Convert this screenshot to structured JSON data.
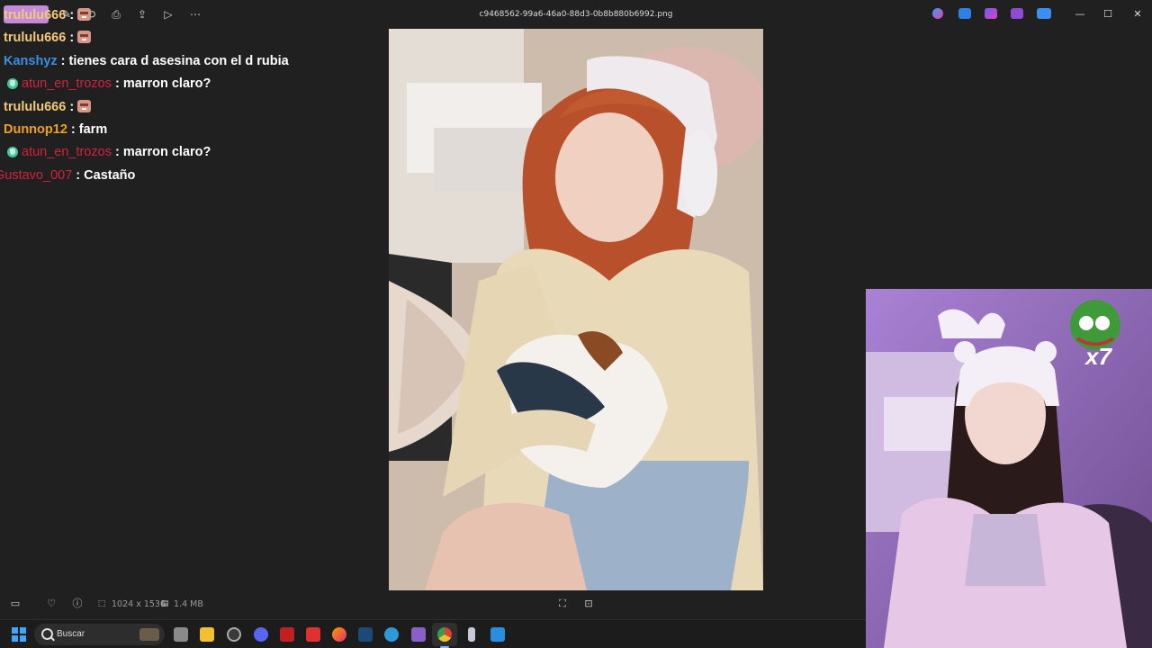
{
  "window": {
    "title": "c9468562-99a6-46a0-88d3-0b8b880b6992.png"
  },
  "toolbar_icons": [
    "image-edit-icon",
    "rotate-icon",
    "print-icon",
    "share-icon",
    "slideshow-icon",
    "more-icon"
  ],
  "chat": {
    "messages": [
      {
        "user": "trululu666",
        "color": "#f2c978",
        "badge": false,
        "text": "",
        "emote": true
      },
      {
        "user": "trululu666",
        "color": "#f2c978",
        "badge": false,
        "text": "",
        "emote": true
      },
      {
        "user": "Kanshyz",
        "color": "#3a8fe0",
        "badge": false,
        "text": "tienes cara d asesina con el d rubia",
        "emote": false
      },
      {
        "user": "atun_en_trozos",
        "color": "#d2223c",
        "badge": true,
        "text": "marron claro?",
        "emote": false
      },
      {
        "user": "trululu666",
        "color": "#f2c978",
        "badge": false,
        "text": "",
        "emote": true
      },
      {
        "user": "Dunnop12",
        "color": "#f0a020",
        "badge": false,
        "text": "farm",
        "emote": false
      },
      {
        "user": "atun_en_trozos",
        "color": "#d2223c",
        "badge": true,
        "text": "marron claro?",
        "emote": false
      },
      {
        "user": "Gustavo_007",
        "color": "#d2223c",
        "badge": false,
        "text": "Castaño",
        "emote": false
      }
    ],
    "separator": ":"
  },
  "overlay": {
    "multiplier": "x7"
  },
  "status": {
    "dimensions": "1024 x 1536",
    "size": "1.4 MB"
  },
  "taskbar": {
    "search_placeholder": "Buscar",
    "apps": [
      "task-view-icon",
      "file-explorer-icon",
      "app-icon",
      "discord-icon",
      "news-app-icon",
      "media-app-icon",
      "firefox-icon",
      "steam-icon",
      "refresh-app-icon",
      "obs-icon",
      "chrome-icon",
      "notes-app-icon",
      "photos-app-icon"
    ]
  }
}
